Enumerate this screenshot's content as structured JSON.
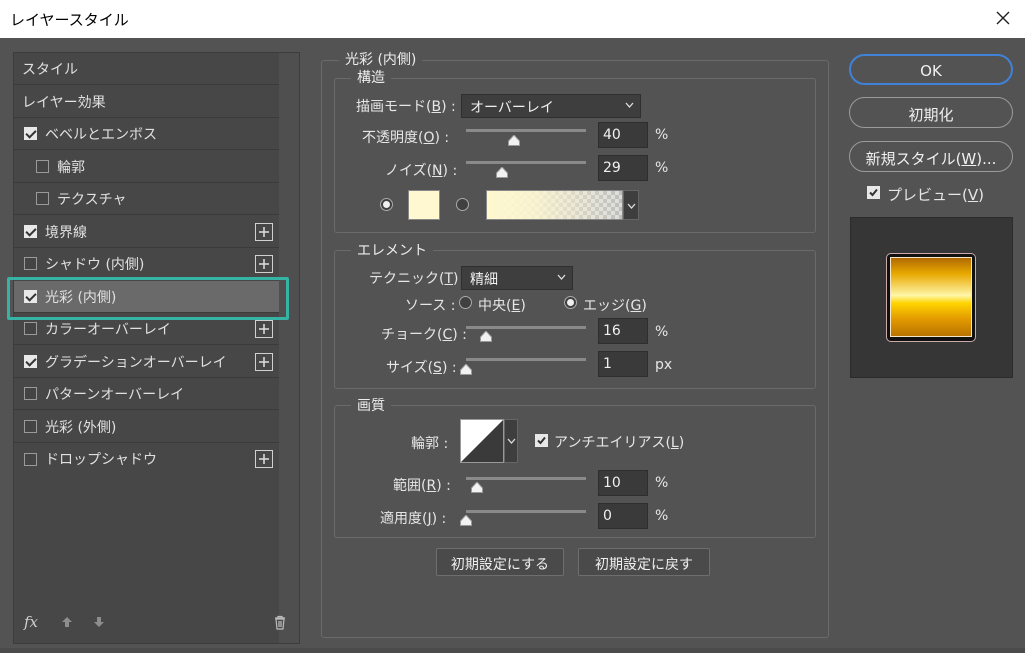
{
  "window": {
    "title": "レイヤースタイル"
  },
  "left_panel": {
    "items": [
      {
        "label": "スタイル",
        "checkbox": false,
        "checked": false,
        "plus": false
      },
      {
        "label": "レイヤー効果",
        "checkbox": false,
        "checked": false,
        "plus": false
      },
      {
        "label": "ベベルとエンボス",
        "checkbox": true,
        "checked": true,
        "plus": false
      },
      {
        "label": "輪郭",
        "checkbox": true,
        "checked": false,
        "plus": false,
        "indent": true
      },
      {
        "label": "テクスチャ",
        "checkbox": true,
        "checked": false,
        "plus": false,
        "indent": true
      },
      {
        "label": "境界線",
        "checkbox": true,
        "checked": true,
        "plus": true
      },
      {
        "label": "シャドウ (内側)",
        "checkbox": true,
        "checked": false,
        "plus": true
      },
      {
        "label": "光彩 (内側)",
        "checkbox": true,
        "checked": true,
        "plus": false,
        "selected": true
      },
      {
        "label": "カラーオーバーレイ",
        "checkbox": true,
        "checked": false,
        "plus": true
      },
      {
        "label": "グラデーションオーバーレイ",
        "checkbox": true,
        "checked": true,
        "plus": true
      },
      {
        "label": "パターンオーバーレイ",
        "checkbox": true,
        "checked": false,
        "plus": false
      },
      {
        "label": "光彩 (外側)",
        "checkbox": true,
        "checked": false,
        "plus": false
      },
      {
        "label": "ドロップシャドウ",
        "checkbox": true,
        "checked": false,
        "plus": true
      }
    ],
    "fx_label": "fx"
  },
  "inner_glow": {
    "section_title": "光彩 (内側)",
    "structure": {
      "title": "構造",
      "blend_mode_label": "描画モード(",
      "blend_mode_key": "B",
      "blend_mode_value": "オーバーレイ",
      "opacity_label": "不透明度(",
      "opacity_key": "O",
      "opacity_value": "40",
      "noise_label": "ノイズ(",
      "noise_key": "N",
      "noise_value": "29",
      "percent": "%",
      "glow_color": "#fff8d0"
    },
    "elements": {
      "title": "エレメント",
      "technique_label": "テクニック(",
      "technique_key": "T",
      "technique_value": "精細",
      "source_label": "ソース :",
      "source_center": "中央(",
      "source_center_key": "E",
      "source_edge": "エッジ(",
      "source_edge_key": "G",
      "choke_label": "チョーク(",
      "choke_key": "C",
      "choke_value": "16",
      "size_label": "サイズ(",
      "size_key": "S",
      "size_value": "1",
      "px": "px"
    },
    "quality": {
      "title": "画質",
      "contour_label": "輪郭 :",
      "antialias_label": "アンチエイリアス(",
      "antialias_key": "L",
      "range_label": "範囲(",
      "range_key": "R",
      "range_value": "10",
      "jitter_label": "適用度(",
      "jitter_key": "J",
      "jitter_value": "0"
    },
    "make_default": "初期設定にする",
    "reset_default": "初期設定に戻す"
  },
  "right_panel": {
    "ok": "OK",
    "reset": "初期化",
    "new_style_prefix": "新規スタイル(",
    "new_style_key": "W",
    "new_style_suffix": ")...",
    "preview_prefix": "プレビュー(",
    "preview_key": "V"
  },
  "colors": {
    "accent_highlight": "#35b3a5",
    "ok_border": "#3f82d7",
    "panel_bg": "#535353"
  }
}
